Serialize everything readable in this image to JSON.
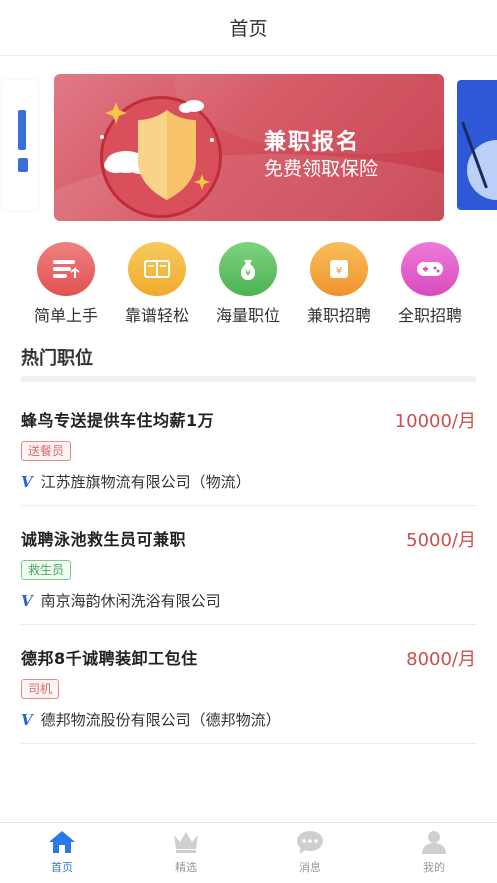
{
  "header": {
    "title": "首页"
  },
  "banner": {
    "title": "兼职报名",
    "subtitle": "免费领取保险"
  },
  "categories": [
    {
      "label": "简单上手",
      "color": "#ea5f5f"
    },
    {
      "label": "靠谱轻松",
      "color": "#f3b63a"
    },
    {
      "label": "海量职位",
      "color": "#5cc25e"
    },
    {
      "label": "兼职招聘",
      "color": "#f4a33b"
    },
    {
      "label": "全职招聘",
      "color": "#e458c8"
    }
  ],
  "section": {
    "title": "热门职位"
  },
  "jobs": [
    {
      "title": "蜂鸟专送提供车住均薪1万",
      "salary": "10000/月",
      "tag": "送餐员",
      "tag_color": "red",
      "company": "江苏旌旗物流有限公司（物流）"
    },
    {
      "title": "诚聘泳池救生员可兼职",
      "salary": "5000/月",
      "tag": "救生员",
      "tag_color": "green",
      "company": "南京海韵休闲洗浴有限公司"
    },
    {
      "title": "德邦8千诚聘装卸工包住",
      "salary": "8000/月",
      "tag": "司机",
      "tag_color": "red",
      "company": "德邦物流股份有限公司（德邦物流）"
    }
  ],
  "verified_mark": "V",
  "tabbar": [
    {
      "label": "首页",
      "icon": "home-icon",
      "active": true
    },
    {
      "label": "精选",
      "icon": "crown-icon",
      "active": false
    },
    {
      "label": "消息",
      "icon": "chat-icon",
      "active": false
    },
    {
      "label": "我的",
      "icon": "user-icon",
      "active": false
    }
  ],
  "colors": {
    "accent": "#2c78e6",
    "salary": "#c9504f",
    "banner": "#c43b4a"
  }
}
